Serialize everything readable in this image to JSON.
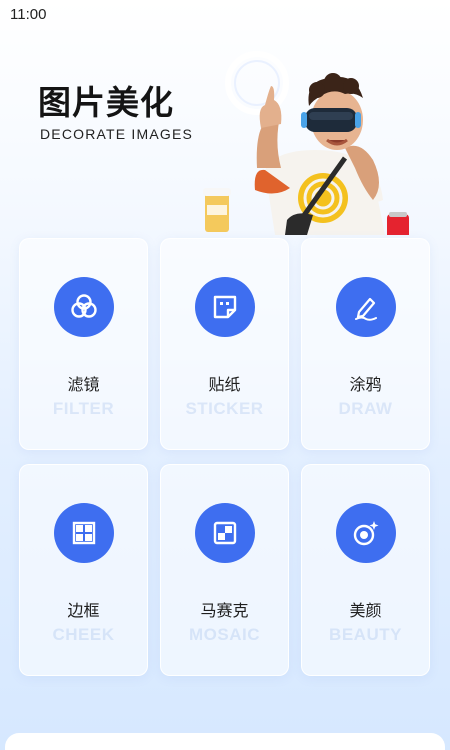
{
  "status_bar": {
    "time": "11:00"
  },
  "hero": {
    "title": "图片美化",
    "subtitle": "DECORATE IMAGES"
  },
  "tools": [
    {
      "label": "滤镜",
      "label_en": "FILTER",
      "icon": "filter-icon"
    },
    {
      "label": "贴纸",
      "label_en": "STICKER",
      "icon": "sticker-icon"
    },
    {
      "label": "涂鸦",
      "label_en": "DRAW",
      "icon": "draw-icon"
    },
    {
      "label": "边框",
      "label_en": "CHEEK",
      "icon": "frame-icon"
    },
    {
      "label": "马赛克",
      "label_en": "MOSAIC",
      "icon": "mosaic-icon"
    },
    {
      "label": "美颜",
      "label_en": "BEAUTY",
      "icon": "beauty-icon"
    }
  ],
  "colors": {
    "accent": "#3e6ef0",
    "background_top": "#ffffff",
    "background_bottom": "#d6e8ff"
  }
}
